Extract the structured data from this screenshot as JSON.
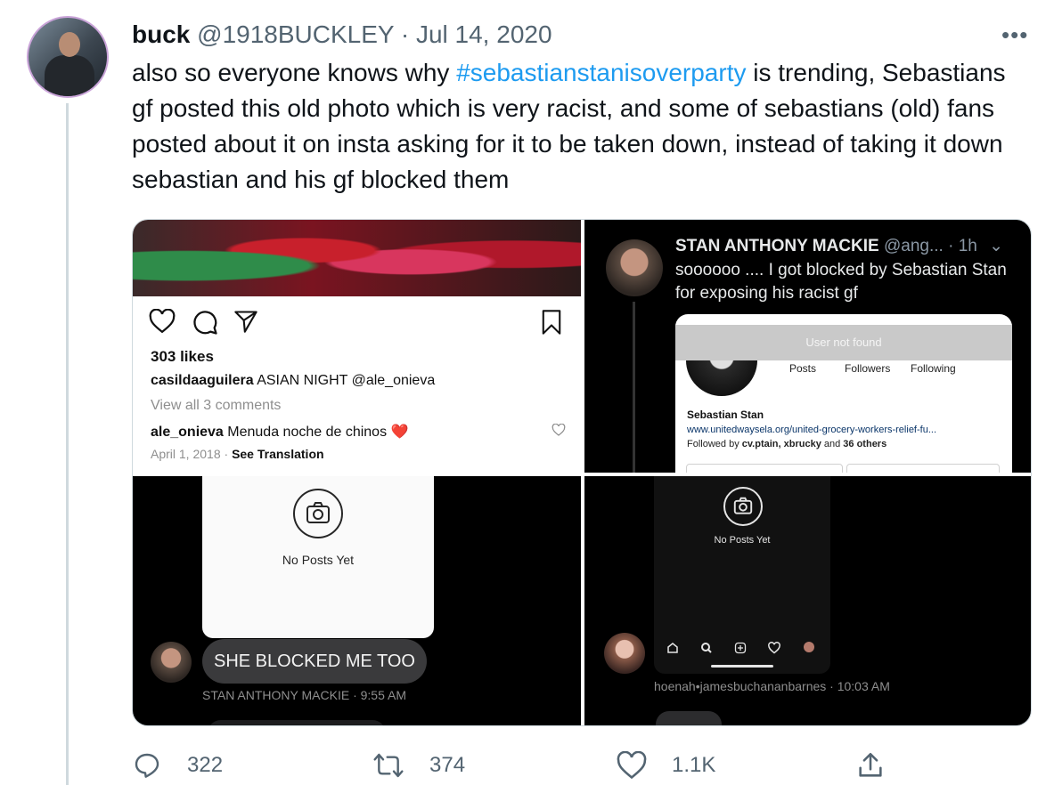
{
  "tweet": {
    "author_name": "buck",
    "author_handle": "@1918BUCKLEY",
    "separator": "·",
    "date": "Jul 14, 2020",
    "text_before": "also so everyone knows why ",
    "hashtag": "#sebastianstanisoverparty",
    "text_after": " is trending, Sebastians gf posted this old photo which is very racist, and some of sebastians (old) fans posted about it on insta asking for it to be taken down, instead of taking it down sebastian and his gf blocked them"
  },
  "media": {
    "instagram_post": {
      "likes": "303 likes",
      "caption_user": "casildaaguilera",
      "caption_text": " ASIAN NIGHT @ale_onieva",
      "view_all": "View all 3 comments",
      "comment_user": "ale_onieva",
      "comment_text": " Menuda noche de chinos ",
      "comment_emoji": "❤️",
      "date": "April 1, 2018",
      "date_sep": " · ",
      "see_translation": "See Translation"
    },
    "dark_tweet": {
      "name": "STAN ANTHONY MACKIE",
      "handle": " @ang...",
      "time": " · 1h",
      "chevron": "⌄",
      "text": "soooooo .... I got blocked by Sebastian Stan for exposing his racist gf",
      "profile_card": {
        "banner": "User not found",
        "posts_label": "Posts",
        "followers_label": "Followers",
        "following_label": "Following",
        "name": "Sebastian Stan",
        "url": "www.unitedwaysela.org/united-grocery-workers-relief-fu...",
        "followed_by_prefix": "Followed by ",
        "followed_by_users": "cv.ptain, xbrucky",
        "followed_by_mid": " and ",
        "followed_by_count": "36 others"
      }
    },
    "dm_left": {
      "no_posts": "No Posts Yet",
      "message": "SHE BLOCKED ME TOO",
      "meta": "STAN ANTHONY MACKIE · 9:55 AM"
    },
    "dm_right": {
      "no_posts": "No Posts Yet",
      "meta": "hoenah•jamesbuchananbarnes · 10:03 AM"
    }
  },
  "actions": {
    "replies": "322",
    "retweets": "374",
    "likes": "1.1K"
  },
  "icons": [
    "more-icon",
    "heart-icon",
    "comment-icon",
    "share-icon",
    "bookmark-icon",
    "camera-icon",
    "home-icon",
    "search-icon",
    "add-icon",
    "reply-icon",
    "retweet-icon",
    "like-icon",
    "upload-icon"
  ],
  "colors": {
    "hashtag": "#1d9bf0",
    "text": "#0f1419",
    "secondary": "#536471"
  }
}
